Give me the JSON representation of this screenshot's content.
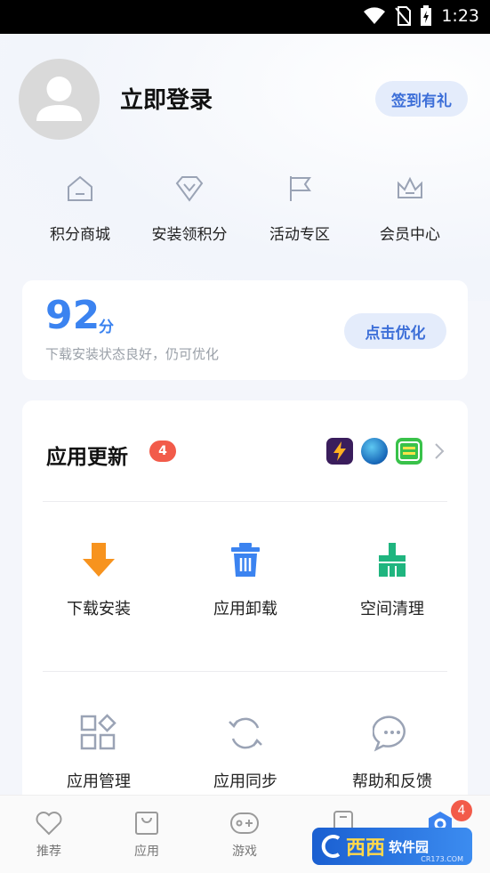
{
  "status_bar": {
    "time": "1:23"
  },
  "profile": {
    "login_text": "立即登录",
    "signin_button": "签到有礼"
  },
  "quick_links": [
    {
      "label": "积分商城",
      "icon": "house-icon"
    },
    {
      "label": "安装领积分",
      "icon": "diamond-icon"
    },
    {
      "label": "活动专区",
      "icon": "flag-icon"
    },
    {
      "label": "会员中心",
      "icon": "crown-icon"
    }
  ],
  "score": {
    "value": "92",
    "unit": "分",
    "description": "下载安装状态良好，仍可优化",
    "button": "点击优化"
  },
  "updates": {
    "title": "应用更新",
    "count": "4",
    "app_icons": [
      "app-icon-lightning",
      "app-icon-globe",
      "app-icon-game-hall"
    ]
  },
  "tools_row1": [
    {
      "label": "下载安装",
      "icon": "download-arrow-icon",
      "color": "#f7931e"
    },
    {
      "label": "应用卸载",
      "icon": "trash-icon",
      "color": "#3b83f0"
    },
    {
      "label": "空间清理",
      "icon": "broom-icon",
      "color": "#1fb57f"
    }
  ],
  "tools_row2": [
    {
      "label": "应用管理",
      "icon": "grid-icon"
    },
    {
      "label": "应用同步",
      "icon": "sync-icon"
    },
    {
      "label": "帮助和反馈",
      "icon": "chat-icon"
    }
  ],
  "bottom_nav": {
    "items": [
      {
        "label": "推荐",
        "icon": "heart-icon"
      },
      {
        "label": "应用",
        "icon": "bag-icon"
      },
      {
        "label": "游戏",
        "icon": "gamepad-icon"
      }
    ],
    "me_badge": "4"
  },
  "watermark": {
    "brand": "西西",
    "text": "软件园",
    "url": "CR173.COM"
  }
}
